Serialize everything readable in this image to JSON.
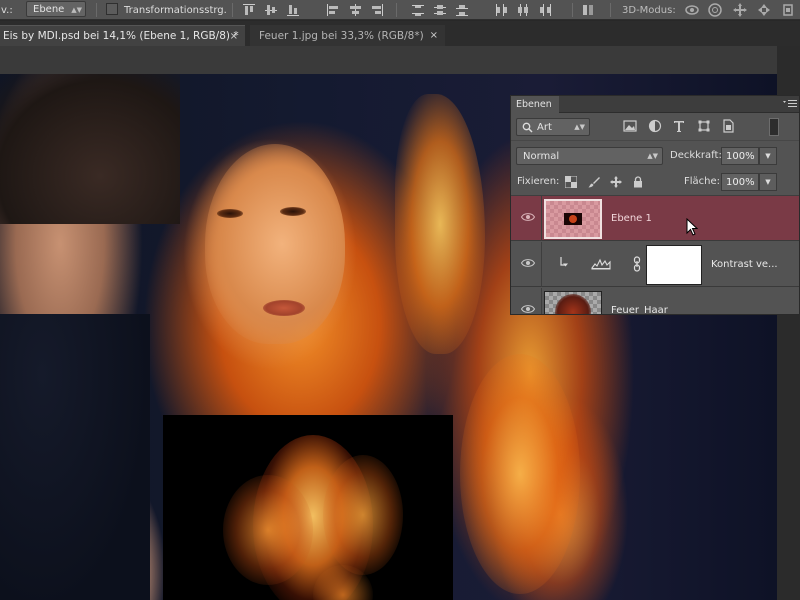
{
  "options_bar": {
    "auto_select_label": "v.:",
    "auto_select_value": "Ebene",
    "transform_label": "Transformationsstrg.",
    "mode3d_label": "3D-Modus:"
  },
  "tabs": [
    {
      "label": "Eis by MDI.psd bei 14,1% (Ebene 1, RGB/8) *",
      "close": "×"
    },
    {
      "label": "Feuer 1.jpg bei 33,3% (RGB/8*)",
      "close": "×"
    }
  ],
  "layers_panel": {
    "title": "Ebenen",
    "filter_value": "Art",
    "blend_mode": "Normal",
    "opacity_label": "Deckkraft:",
    "opacity_value": "100%",
    "lock_label": "Fixieren:",
    "fill_label": "Fläche:",
    "fill_value": "100%",
    "layers": [
      {
        "name": "Ebene 1",
        "selected": true
      },
      {
        "name": "Kontrast ve...",
        "selected": false
      },
      {
        "name": "Feuer_Haar",
        "selected": false
      }
    ]
  },
  "colors": {
    "selected_layer": "#7a3a46",
    "panel_bg": "#535353",
    "options_bar": "#535353"
  },
  "icons": [
    "align-top-icon",
    "align-vcenter-icon",
    "align-bottom-icon",
    "align-left-icon",
    "align-hcenter-icon",
    "align-right-icon",
    "distribute-icon",
    "rotate-3d-icon",
    "roll-3d-icon",
    "drag-3d-icon",
    "slide-3d-icon",
    "scale-3d-icon",
    "eye-icon",
    "lock-icon",
    "chain-icon",
    "curves-icon"
  ]
}
